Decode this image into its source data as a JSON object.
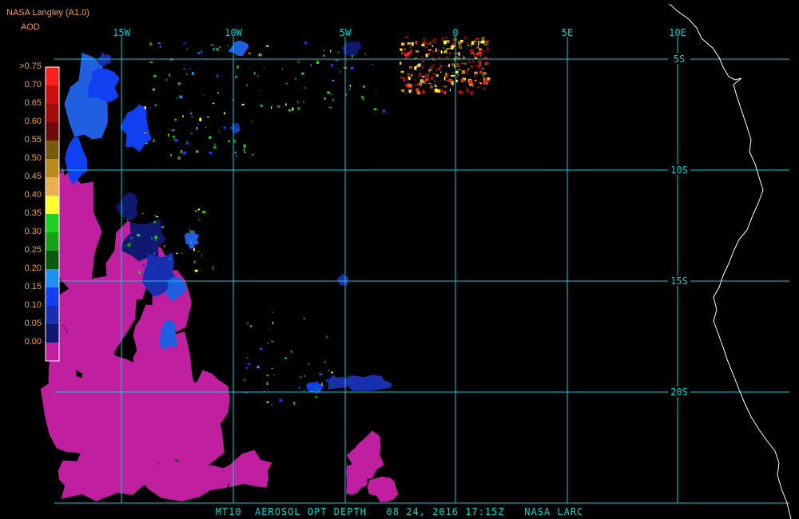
{
  "header": {
    "title": "NASA Langley (A1.0)",
    "subtitle": "AOD"
  },
  "legend": {
    "labels": [
      ">0.75",
      "0.70",
      "0.65",
      "0.60",
      "0.55",
      "0.50",
      "0.45",
      "0.40",
      "0.35",
      "0.30",
      "0.25",
      "0.20",
      "0.15",
      "0.10",
      "0.05",
      "0.00"
    ],
    "colors": [
      "#ff2020",
      "#c81010",
      "#a00c0c",
      "#6e0a0a",
      "#7a5a10",
      "#b88a20",
      "#e8b050",
      "#ffff30",
      "#20d020",
      "#18a018",
      "#0a5a0a",
      "#2090f0",
      "#1040f0",
      "#1830b0",
      "#101870",
      "#c020a0"
    ]
  },
  "map": {
    "lon_labels": [
      "15W",
      "10W",
      "5W",
      "0",
      "5E",
      "10E"
    ],
    "lat_labels": [
      "5S",
      "10S",
      "15S",
      "20S"
    ],
    "grid_color": "#00d0d0",
    "coast_color": "#ffffff"
  },
  "footer": {
    "text": "MT10  AEROSOL OPT DEPTH   08 24, 2016 17:15Z   NASA LARC"
  }
}
